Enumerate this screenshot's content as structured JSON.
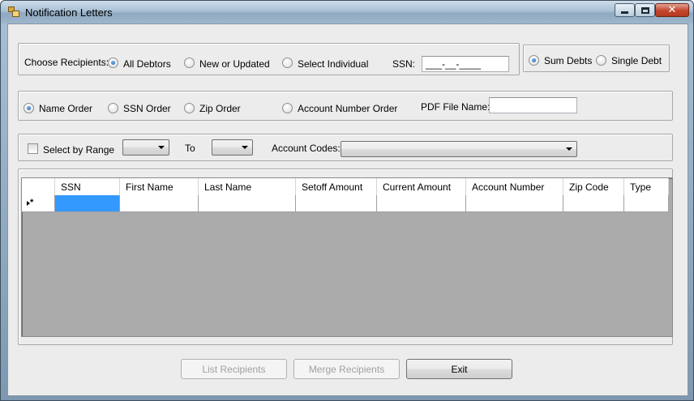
{
  "window": {
    "title": "Notification Letters"
  },
  "recipients": {
    "label": "Choose Recipients:",
    "options": [
      {
        "label": "All Debtors",
        "selected": true
      },
      {
        "label": "New or Updated",
        "selected": false
      },
      {
        "label": "Select Individual",
        "selected": false
      }
    ],
    "ssn_label": "SSN:",
    "ssn_mask": "___-__-____"
  },
  "debt_mode": {
    "options": [
      {
        "label": "Sum Debts",
        "selected": true
      },
      {
        "label": "Single Debt",
        "selected": false
      }
    ]
  },
  "ordering": {
    "options": [
      {
        "label": "Name Order",
        "selected": true
      },
      {
        "label": "SSN Order",
        "selected": false
      },
      {
        "label": "Zip Order",
        "selected": false
      },
      {
        "label": "Account Number Order",
        "selected": false
      }
    ],
    "pdf_label": "PDF File Name:",
    "pdf_value": ""
  },
  "range": {
    "checkbox_label": "Select by Range",
    "checked": false,
    "from_value": "",
    "to_label": "To",
    "to_value": "",
    "account_codes_label": "Account Codes:",
    "account_codes_value": ""
  },
  "grid": {
    "columns": [
      "SSN",
      "First Name",
      "Last Name",
      "Setoff Amount",
      "Current Amount",
      "Account Number",
      "Zip Code",
      "Type"
    ],
    "rows": [
      [
        "",
        "",
        "",
        "",
        "",
        "",
        "",
        ""
      ]
    ],
    "new_row_marker": "*"
  },
  "buttons": {
    "list": "List Recipients",
    "merge": "Merge Recipients",
    "exit": "Exit"
  }
}
